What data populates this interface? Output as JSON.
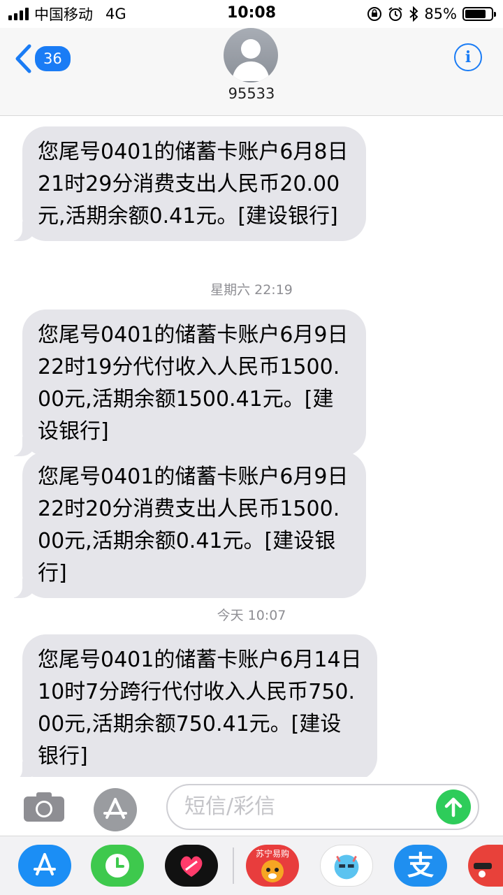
{
  "status_bar": {
    "carrier": "中国移动",
    "network": "4G",
    "time": "10:08",
    "battery": "85%",
    "battery_level": 0.85
  },
  "header": {
    "back_count": "36",
    "contact": "95533",
    "info_label": "i"
  },
  "messages": [
    {
      "text": "您尾号0401的储蓄卡账户6月8日21时29分消费支出人民币20.00元,活期余额0.41元。[建设银行]"
    },
    {
      "timestamp": "星期六 22:19"
    },
    {
      "text": "您尾号0401的储蓄卡账户6月9日22时19分代付收入人民币1500.00元,活期余额1500.41元。[建设银行]"
    },
    {
      "text": "您尾号0401的储蓄卡账户6月9日22时20分消费支出人民币1500.00元,活期余额0.41元。[建设银行]"
    },
    {
      "timestamp": "今天 10:07"
    },
    {
      "text": "您尾号0401的储蓄卡账户6月14日10时7分跨行代付收入人民币750.00元,活期余额750.41元。[建设银行]"
    }
  ],
  "input": {
    "placeholder": "短信/彩信"
  },
  "app_drawer": [
    {
      "icon": "app-store-icon"
    },
    {
      "icon": "clock-icon"
    },
    {
      "icon": "heart-icon"
    },
    {
      "icon": "suning-icon",
      "label": "苏宁易购"
    },
    {
      "icon": "blue-monster-icon"
    },
    {
      "icon": "alipay-icon",
      "label": "支"
    },
    {
      "icon": "red-character-icon"
    }
  ],
  "colors": {
    "accent": "#1a7cf5",
    "bubble": "#e5e5ea",
    "send": "#2ecc5a",
    "timestamp": "#8e8e93"
  }
}
